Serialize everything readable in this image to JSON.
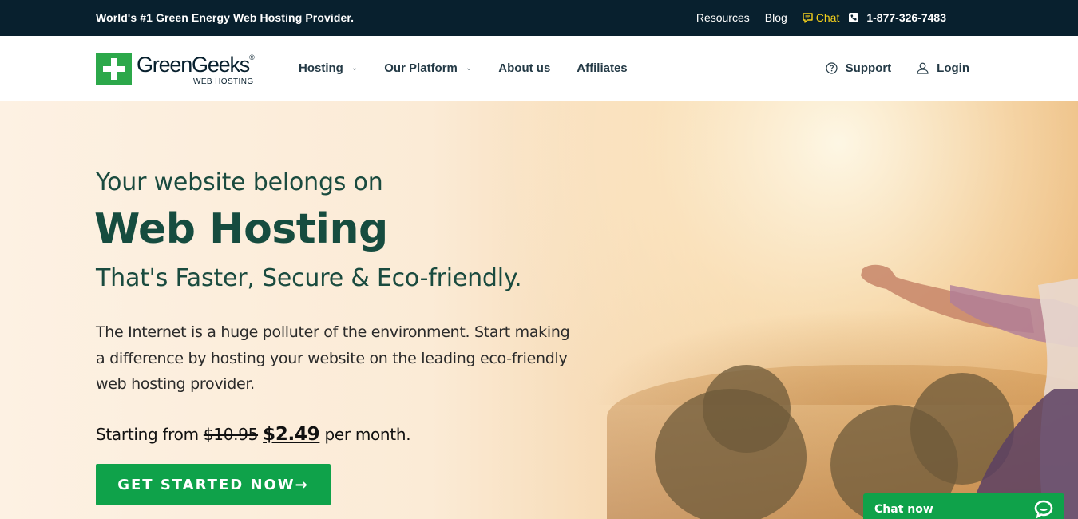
{
  "topbar": {
    "tagline": "World's #1 Green Energy Web Hosting Provider.",
    "links": [
      "Resources",
      "Blog"
    ],
    "chat_label": "Chat",
    "phone": "1-877-326-7483",
    "chat_color": "#f7d21b",
    "bg_color": "#08202e"
  },
  "logo": {
    "name": "GreenGeeks",
    "registered": "®",
    "sub": "WEB HOSTING",
    "icon": "plus-icon",
    "color": "#2ca84a"
  },
  "nav": {
    "items": [
      {
        "label": "Hosting",
        "dropdown": true
      },
      {
        "label": "Our Platform",
        "dropdown": true
      },
      {
        "label": "About us",
        "dropdown": false
      },
      {
        "label": "Affiliates",
        "dropdown": false
      }
    ],
    "support_label": "Support",
    "login_label": "Login"
  },
  "hero": {
    "pre_title": "Your website belongs on",
    "title": "Web Hosting",
    "post_title": "That's Faster, Secure & Eco-friendly.",
    "body": "The Internet is a huge polluter of the environment. Start making a difference by hosting your website on the leading eco-friendly web hosting provider.",
    "price_prefix": "Starting from",
    "old_price": "$10.95",
    "new_price": "$2.49",
    "price_suffix": "per month.",
    "cta_label": "GET STARTED NOW",
    "cta_arrow": "→",
    "cta_color": "#0fa24a"
  },
  "chat_widget": {
    "label": "Chat now",
    "icon": "chat-bubble-icon"
  }
}
